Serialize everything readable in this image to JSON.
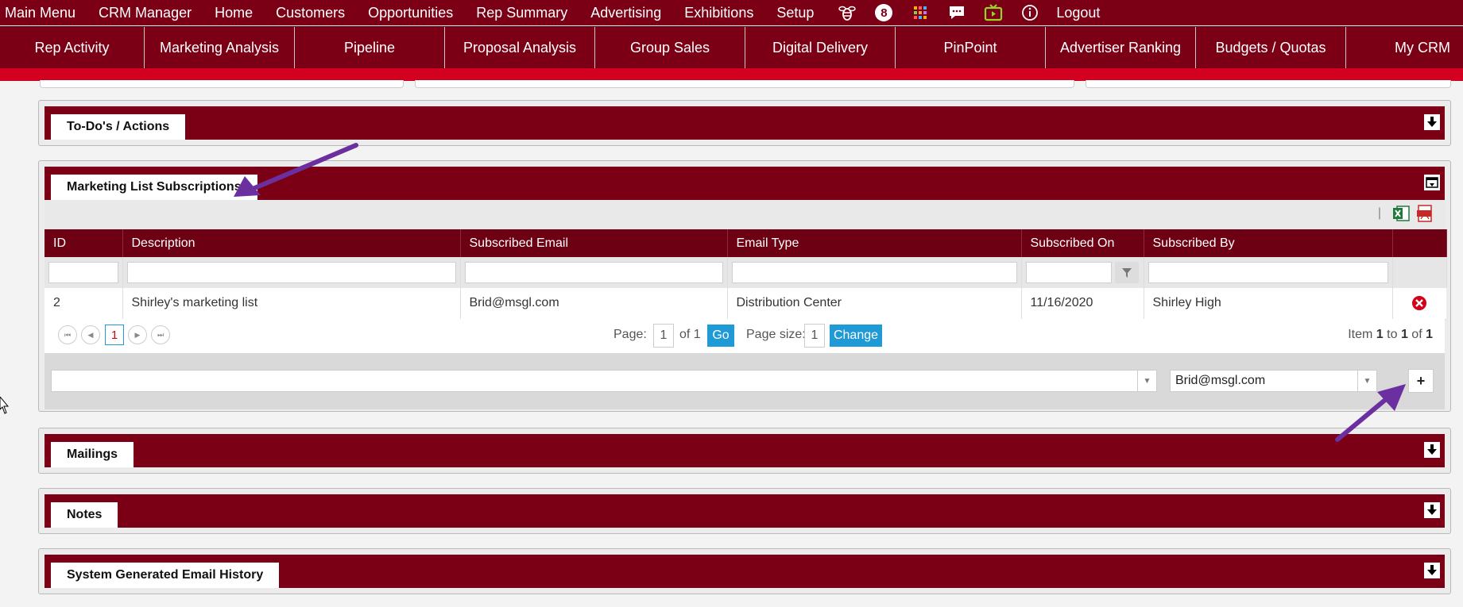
{
  "top_menu": {
    "items_left": [
      "Main Menu",
      "CRM Manager",
      "Home",
      "Customers",
      "Opportunities",
      "Rep Summary",
      "Advertising",
      "Exhibitions",
      "Setup"
    ],
    "badge_count": "8",
    "logout": "Logout"
  },
  "nav": [
    "Rep Activity",
    "Marketing Analysis",
    "Pipeline",
    "Proposal Analysis",
    "Group Sales",
    "Digital Delivery",
    "PinPoint",
    "Advertiser Ranking",
    "Budgets / Quotas",
    "My CRM"
  ],
  "panels": {
    "todo": "To-Do's / Actions",
    "marketing": "Marketing List Subscriptions",
    "mailings": "Mailings",
    "notes": "Notes",
    "email_history": "System Generated Email History"
  },
  "grid": {
    "columns": [
      "ID",
      "Description",
      "Subscribed Email",
      "Email Type",
      "Subscribed On",
      "Subscribed By"
    ],
    "rows": [
      [
        "2",
        "Shirley's marketing list",
        "Brid@msgl.com",
        "Distribution Center",
        "11/16/2020",
        "Shirley High"
      ]
    ]
  },
  "pager": {
    "current_page": "1",
    "page_label": "Page:",
    "page_value": "1",
    "of_label": "of 1",
    "go": "Go",
    "size_label": "Page size:",
    "size_value": "1",
    "change": "Change",
    "item_prefix": "Item",
    "item_from": "1",
    "item_to_label": "to",
    "item_to": "1",
    "item_of_label": "of",
    "item_total": "1"
  },
  "add_form": {
    "list_value": "",
    "email_value": "Brid@msgl.com",
    "add_symbol": "+"
  },
  "colors": {
    "brand": "#7b0015",
    "accent_red": "#d4001f",
    "pager_button": "#1f9ad6",
    "arrow": "#6b2fa0"
  }
}
